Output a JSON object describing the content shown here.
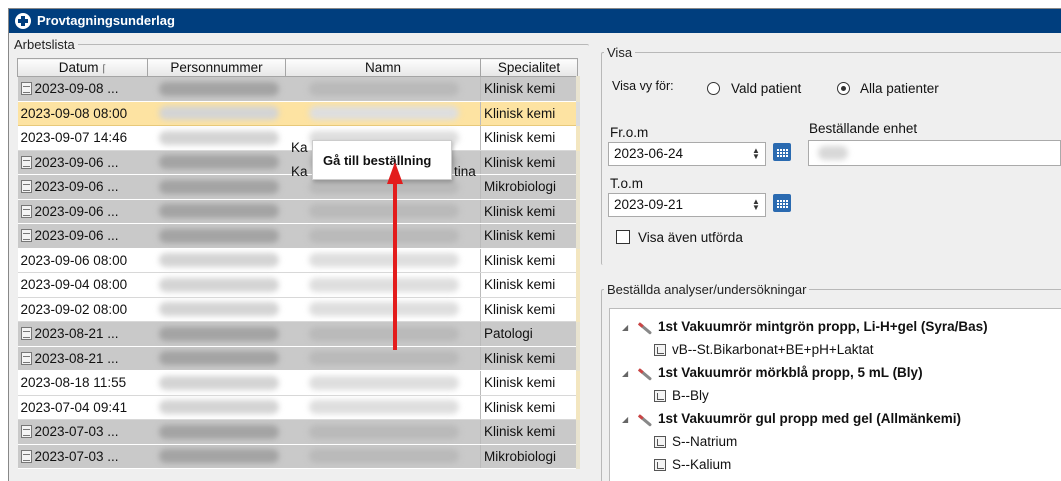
{
  "window": {
    "title": "Provtagningsunderlag"
  },
  "worklist": {
    "legend": "Arbetslista",
    "columns": [
      "Datum",
      "Personnummer",
      "Namn",
      "Specialitet"
    ],
    "sort_indicator": "⌈",
    "rows": [
      {
        "date": "2023-09-08 ...",
        "specialty": "Klinisk kemi",
        "style": "g",
        "doc": true
      },
      {
        "date": "2023-09-08 08:00",
        "specialty": "Klinisk kemi",
        "style": "y",
        "doc": false
      },
      {
        "date": "2023-09-07 14:46",
        "specialty": "Klinisk kemi",
        "style": "w",
        "doc": false
      },
      {
        "date": "2023-09-06 ...",
        "specialty": "Klinisk kemi",
        "style": "g",
        "doc": true
      },
      {
        "date": "2023-09-06 ...",
        "specialty": "Mikrobiologi",
        "style": "g",
        "doc": true
      },
      {
        "date": "2023-09-06 ...",
        "specialty": "Klinisk kemi",
        "style": "g",
        "doc": true
      },
      {
        "date": "2023-09-06 ...",
        "specialty": "Klinisk kemi",
        "style": "g",
        "doc": true
      },
      {
        "date": "2023-09-06 08:00",
        "specialty": "Klinisk kemi",
        "style": "w",
        "doc": false
      },
      {
        "date": "2023-09-04 08:00",
        "specialty": "Klinisk kemi",
        "style": "w",
        "doc": false
      },
      {
        "date": "2023-09-02 08:00",
        "specialty": "Klinisk kemi",
        "style": "w",
        "doc": false
      },
      {
        "date": "2023-08-21 ...",
        "specialty": "Patologi",
        "style": "g",
        "doc": true
      },
      {
        "date": "2023-08-21 ...",
        "specialty": "Klinisk kemi",
        "style": "g",
        "doc": true
      },
      {
        "date": "2023-08-18 11:55",
        "specialty": "Klinisk kemi",
        "style": "w",
        "doc": false
      },
      {
        "date": "2023-07-04 09:41",
        "specialty": "Klinisk kemi",
        "style": "w",
        "doc": false
      },
      {
        "date": "2023-07-03 ...",
        "specialty": "Klinisk kemi",
        "style": "g",
        "doc": true
      },
      {
        "date": "2023-07-03 ...",
        "specialty": "Mikrobiologi",
        "style": "g",
        "doc": true
      }
    ],
    "partial_names": {
      "row3": "Ka",
      "row4": "Ka",
      "row4_end": "tina"
    }
  },
  "tooltip": {
    "text": "Gå till beställning"
  },
  "visa": {
    "legend": "Visa",
    "view_for_label": "Visa vy för:",
    "radio_selected_patient": "Vald patient",
    "radio_all_patients": "Alla patienter",
    "selected": "all",
    "from_label": "Fr.o.m",
    "from_value": "2023-06-24",
    "to_label": "T.o.m",
    "to_value": "2023-09-21",
    "ordering_unit_label": "Beställande enhet",
    "show_completed_label": "Visa även utförda",
    "show_completed": false
  },
  "ordered": {
    "legend": "Beställda analyser/undersökningar",
    "groups": [
      {
        "title": "1st Vakuumrör mintgrön propp, Li-H+gel (Syra/Bas)",
        "items": [
          "vB--St.Bikarbonat+BE+pH+Laktat"
        ]
      },
      {
        "title": "1st Vakuumrör mörkblå propp, 5 mL (Bly)",
        "items": [
          "B--Bly"
        ]
      },
      {
        "title": "1st Vakuumrör gul propp med gel (Allmänkemi)",
        "items": [
          "S--Natrium",
          "S--Kalium"
        ]
      }
    ]
  }
}
